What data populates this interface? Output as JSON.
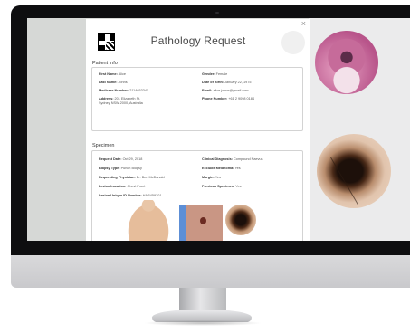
{
  "window": {
    "title": "Pathology Request",
    "close_glyph": "×",
    "stamp_text": ""
  },
  "patient": {
    "section_title": "Patient Info",
    "first_name": {
      "label": "First Name:",
      "value": "Alice"
    },
    "last_name": {
      "label": "Last Name:",
      "value": "Johns"
    },
    "medicare": {
      "label": "Medicare Number:",
      "value": "2114653341"
    },
    "address": {
      "label": "Address:",
      "value": "201 Elizabeth St, Sydney NSW 2000, Australia"
    },
    "gender": {
      "label": "Gender:",
      "value": "Female"
    },
    "dob": {
      "label": "Date of Birth:",
      "value": "January 22, 1975"
    },
    "email": {
      "label": "Email:",
      "value": "alice.johns@gmail.com"
    },
    "phone": {
      "label": "Phone Number:",
      "value": "+61 2 9098 0184"
    }
  },
  "specimen": {
    "section_title": "Specimen",
    "request_date": {
      "label": "Request Date:",
      "value": "Oct 29, 2018"
    },
    "biopsy_type": {
      "label": "Biopsy Type:",
      "value": "Punch Biopsy"
    },
    "physician": {
      "label": "Requesting Physician:",
      "value": "Dr. Ben McDonald"
    },
    "location": {
      "label": "Lesion Location:",
      "value": "Chest Front"
    },
    "unique_id": {
      "label": "Lesion Unique ID Number:",
      "value": "HAR459201"
    },
    "diagnosis": {
      "label": "Clinical Diagnosis:",
      "value": "Compound Naevus"
    },
    "exclude_melanoma": {
      "label": "Exclude Melanoma:",
      "value": "Yes"
    },
    "margin": {
      "label": "Margin:",
      "value": "Yes"
    },
    "previous_specimen": {
      "label": "Previous Specimen:",
      "value": "Yes"
    }
  },
  "icons": [
    "qr-code-icon",
    "close-icon"
  ],
  "colors": {
    "ruler_blue": "#5d8fd6",
    "histology_pink": "#c66b9a",
    "lesion_dark": "#1b0f0a"
  }
}
